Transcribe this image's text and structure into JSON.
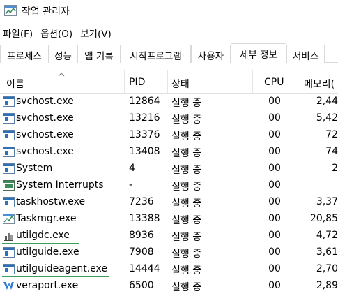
{
  "window": {
    "title": "작업 관리자",
    "icon": "task-manager-icon"
  },
  "menu": [
    {
      "label": "파일(F)"
    },
    {
      "label": "옵션(O)"
    },
    {
      "label": "보기(V)"
    }
  ],
  "tabs": [
    {
      "label": "프로세스"
    },
    {
      "label": "성능"
    },
    {
      "label": "앱 기록"
    },
    {
      "label": "시작프로그램"
    },
    {
      "label": "사용자"
    },
    {
      "label": "세부 정보",
      "active": true
    },
    {
      "label": "서비스"
    }
  ],
  "columns": {
    "name": "이름",
    "pid": "PID",
    "status": "상태",
    "cpu": "CPU",
    "memory": "메모리("
  },
  "processes": [
    {
      "name": "svchost.exe",
      "pid": "12864",
      "status": "실행 중",
      "cpu": "00",
      "memory": "2,44",
      "icon": "service-host-icon"
    },
    {
      "name": "svchost.exe",
      "pid": "13216",
      "status": "실행 중",
      "cpu": "00",
      "memory": "5,42",
      "icon": "service-host-icon"
    },
    {
      "name": "svchost.exe",
      "pid": "13376",
      "status": "실행 중",
      "cpu": "00",
      "memory": "72",
      "icon": "service-host-icon"
    },
    {
      "name": "svchost.exe",
      "pid": "13408",
      "status": "실행 중",
      "cpu": "00",
      "memory": "74",
      "icon": "service-host-icon"
    },
    {
      "name": "System",
      "pid": "4",
      "status": "실행 중",
      "cpu": "00",
      "memory": "2",
      "icon": "system-icon"
    },
    {
      "name": "System Interrupts",
      "pid": "-",
      "status": "실행 중",
      "cpu": "00",
      "memory": "",
      "icon": "system-interrupts-icon"
    },
    {
      "name": "taskhostw.exe",
      "pid": "7236",
      "status": "실행 중",
      "cpu": "00",
      "memory": "3,37",
      "icon": "task-host-icon"
    },
    {
      "name": "Taskmgr.exe",
      "pid": "13388",
      "status": "실행 중",
      "cpu": "00",
      "memory": "20,85",
      "icon": "task-manager-icon"
    },
    {
      "name": "utilgdc.exe",
      "pid": "8936",
      "status": "실행 중",
      "cpu": "00",
      "memory": "4,72",
      "icon": "utilgdc-icon"
    },
    {
      "name": "utilguide.exe",
      "pid": "7908",
      "status": "실행 중",
      "cpu": "00",
      "memory": "3,61",
      "icon": "utilguide-icon"
    },
    {
      "name": "utilguideagent.exe",
      "pid": "14444",
      "status": "실행 중",
      "cpu": "00",
      "memory": "2,70",
      "icon": "utilguideagent-icon"
    },
    {
      "name": "veraport.exe",
      "pid": "6500",
      "status": "실행 중",
      "cpu": "00",
      "memory": "2,89",
      "icon": "veraport-icon"
    }
  ]
}
